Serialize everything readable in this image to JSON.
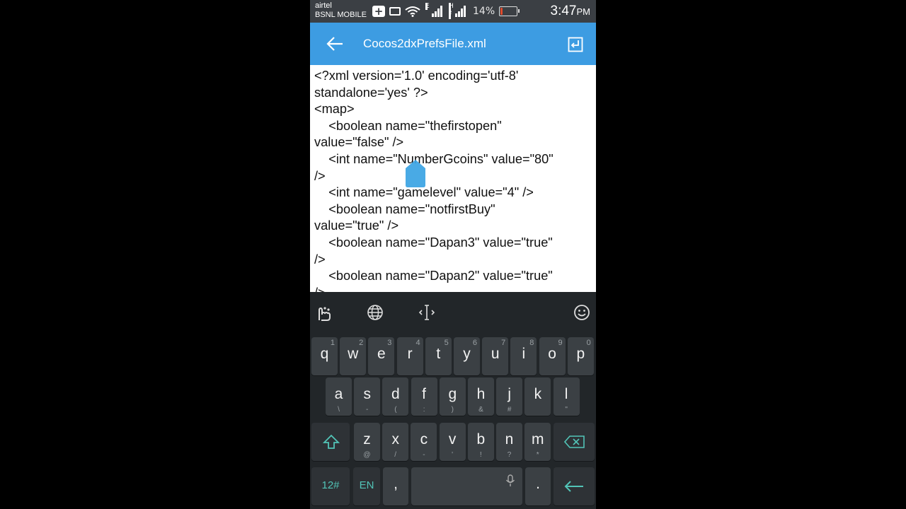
{
  "status_bar": {
    "carrier_1": "airtel",
    "carrier_2": "BSNL MOBILE",
    "network_1": "E",
    "network_2": "H",
    "network_2_sup": "2",
    "battery_percent": "14%",
    "battery_level": 0.14,
    "time": "3:47",
    "ampm": "PM",
    "icons": [
      "plus-notification-icon",
      "video-camera-icon",
      "wifi-icon",
      "signal-icon",
      "battery-icon"
    ]
  },
  "app_bar": {
    "title": "Cocos2dxPrefsFile.xml",
    "back_icon": "arrow-left-icon",
    "action_icon": "exit-icon"
  },
  "editor": {
    "lines": [
      "<?xml version='1.0' encoding='utf-8'",
      "standalone='yes' ?>",
      "<map>",
      "    <boolean name=\"thefirstopen\"",
      "value=\"false\" />",
      "    <int name=\"NumberGcoins\" value=\"80\"",
      "/>",
      "    <int name=\"gamelevel\" value=\"4\" />",
      "    <boolean name=\"notfirstBuy\"",
      "value=\"true\" />",
      "    <boolean name=\"Dapan3\" value=\"true\"",
      "/>",
      "    <boolean name=\"Dapan2\" value=\"true\"",
      "/>"
    ]
  },
  "keyboard": {
    "toolbar": [
      "touchpal-icon",
      "globe-icon",
      "cursor-move-icon",
      "emoji-icon"
    ],
    "row1": [
      {
        "k": "q",
        "n": "1"
      },
      {
        "k": "w",
        "n": "2"
      },
      {
        "k": "e",
        "n": "3"
      },
      {
        "k": "r",
        "n": "4"
      },
      {
        "k": "t",
        "n": "5"
      },
      {
        "k": "y",
        "n": "6"
      },
      {
        "k": "u",
        "n": "7"
      },
      {
        "k": "i",
        "n": "8"
      },
      {
        "k": "o",
        "n": "9"
      },
      {
        "k": "p",
        "n": "0"
      }
    ],
    "row2": [
      {
        "k": "a",
        "s": "\\"
      },
      {
        "k": "s",
        "s": "-"
      },
      {
        "k": "d",
        "s": "("
      },
      {
        "k": "f",
        "s": ":"
      },
      {
        "k": "g",
        "s": ")"
      },
      {
        "k": "h",
        "s": "&"
      },
      {
        "k": "j",
        "s": "#"
      },
      {
        "k": "k",
        "s": ""
      },
      {
        "k": "l",
        "s": "\""
      }
    ],
    "row3": [
      {
        "k": "z",
        "s": "@"
      },
      {
        "k": "x",
        "s": "/"
      },
      {
        "k": "c",
        "s": "-"
      },
      {
        "k": "v",
        "s": "'"
      },
      {
        "k": "b",
        "s": "!"
      },
      {
        "k": "n",
        "s": "?"
      },
      {
        "k": "m",
        "s": "*"
      }
    ],
    "shift_icon": "shift-icon",
    "backspace_icon": "backspace-icon",
    "symbols_label": "12#",
    "language_label": "EN",
    "comma_label": ",",
    "period_label": ".",
    "mic_icon": "microphone-icon",
    "enter_icon": "enter-arrow-icon",
    "accent_color": "#52c4b7"
  }
}
